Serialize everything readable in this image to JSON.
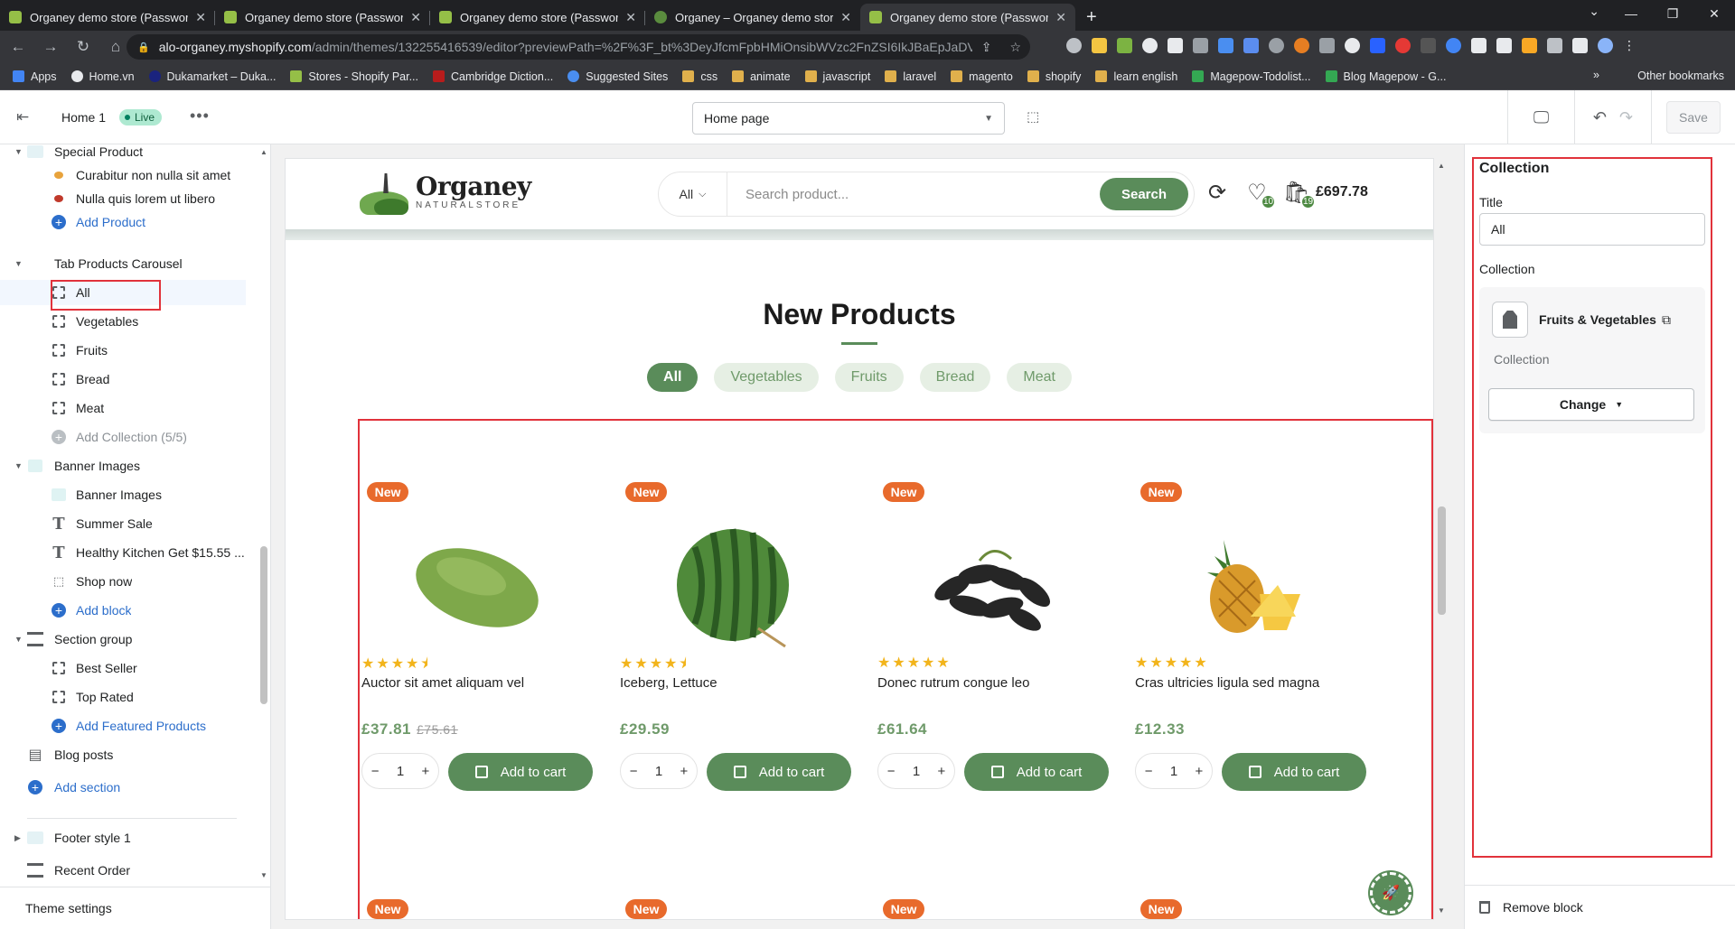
{
  "browser": {
    "tabs": [
      {
        "title": "Organey demo store (Password: d"
      },
      {
        "title": "Organey demo store (Password: d"
      },
      {
        "title": "Organey demo store (Password: d"
      },
      {
        "title": "Organey – Organey demo store (P"
      },
      {
        "title": "Organey demo store (Password: d"
      }
    ],
    "url_host": "alo-organey.myshopify.com",
    "url_path": "/admin/themes/132255416539/editor?previewPath=%2F%3F_bt%3DeyJfcmFpbHMiOnsibWVzc2FnZSI6IkJBaEpJaDVoYkc4...",
    "bookmarks": [
      "Apps",
      "Home.vn",
      "Dukamarket – Duka...",
      "Stores - Shopify Par...",
      "Cambridge Diction...",
      "Suggested Sites",
      "css",
      "animate",
      "javascript",
      "laravel",
      "magento",
      "shopify",
      "learn english",
      "Magepow-Todolist...",
      "Blog Magepow - G..."
    ],
    "other_bookmarks": "Other bookmarks"
  },
  "editor": {
    "template_name": "Home 1",
    "live_label": "Live",
    "page_select": "Home page",
    "save_label": "Save"
  },
  "sidebar": {
    "rows": [
      {
        "label": "Special Product"
      },
      {
        "label": "Curabitur non nulla sit amet"
      },
      {
        "label": "Nulla quis lorem ut libero"
      },
      {
        "label": "Add Product"
      },
      {
        "label": "Tab Products Carousel"
      },
      {
        "label": "All"
      },
      {
        "label": "Vegetables"
      },
      {
        "label": "Fruits"
      },
      {
        "label": "Bread"
      },
      {
        "label": "Meat"
      },
      {
        "label": "Add Collection (5/5)"
      },
      {
        "label": "Banner Images"
      },
      {
        "label": "Banner Images"
      },
      {
        "label": "Summer Sale"
      },
      {
        "label": "Healthy Kitchen Get $15.55 ..."
      },
      {
        "label": "Shop now"
      },
      {
        "label": "Add block"
      },
      {
        "label": "Section group"
      },
      {
        "label": "Best Seller"
      },
      {
        "label": "Top Rated"
      },
      {
        "label": "Add Featured Products"
      },
      {
        "label": "Blog posts"
      },
      {
        "label": "Add section"
      },
      {
        "label": "Footer style 1"
      },
      {
        "label": "Recent Order"
      }
    ],
    "theme_settings": "Theme settings"
  },
  "store": {
    "logo_main": "Organey",
    "logo_sub": "NATURALSTORE",
    "search_category": "All",
    "search_placeholder": "Search product...",
    "search_button": "Search",
    "wishlist_count": "10",
    "cart_count": "19",
    "cart_total": "£697.78",
    "section_title": "New Products",
    "filters": [
      "All",
      "Vegetables",
      "Fruits",
      "Bread",
      "Meat"
    ],
    "badge_label": "New",
    "products": [
      {
        "name": "Auctor sit amet aliquam vel",
        "price": "£37.81",
        "old_price": "£75.61",
        "qty": "1",
        "stars": "★★★★⯨"
      },
      {
        "name": "Iceberg, Lettuce",
        "price": "£29.59",
        "old_price": "",
        "qty": "1",
        "stars": "★★★★⯨"
      },
      {
        "name": "Donec rutrum congue leo",
        "price": "£61.64",
        "old_price": "",
        "qty": "1",
        "stars": "★★★★★"
      },
      {
        "name": "Cras ultricies ligula sed magna",
        "price": "£12.33",
        "old_price": "",
        "qty": "1",
        "stars": "★★★★★"
      }
    ],
    "add_to_cart": "Add to cart"
  },
  "panel": {
    "heading": "Collection",
    "title_label": "Title",
    "title_value": "All",
    "collection_label": "Collection",
    "collection_name": "Fruits & Vegetables",
    "collection_sub": "Collection",
    "change_label": "Change",
    "remove_label": "Remove block"
  }
}
